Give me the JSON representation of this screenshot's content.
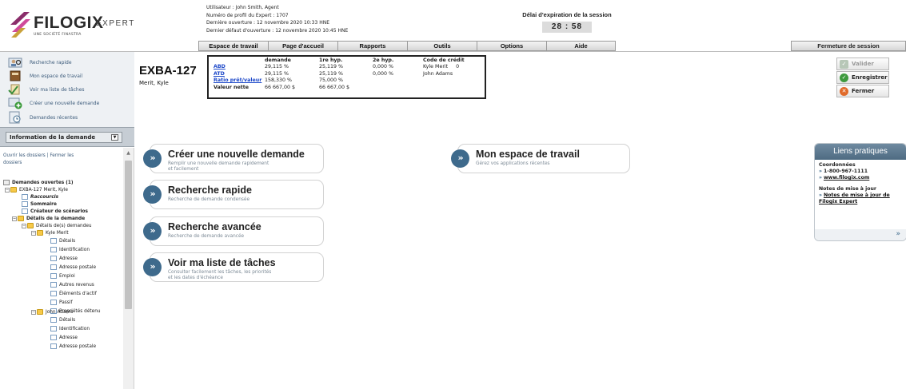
{
  "brand": {
    "name": "FILOGIX",
    "edition": "EXPERT",
    "tagline": "UNE SOCIÉTÉ FINASTRA",
    "colors": {
      "mark_top": "#8a2d6a",
      "mark_mid": "#d04a9a",
      "mark_bottom": "#c9a13a",
      "accent": "#3e6a8c"
    }
  },
  "user_info": {
    "user": "Utilisateur : John Smith, Agent",
    "profile": "Numéro de profil du Expert : 1707",
    "last_open": "Dernière ouverture : 12 novembre 2020 10:33 HNE",
    "last_failed": "Dernier défaut d'ouverture : 12 novembre 2020 10:45 HNE"
  },
  "session": {
    "label": "Délai d'expiration de la session",
    "timer": "28 : 58"
  },
  "topnav": {
    "tabs": [
      "Espace de travail",
      "Page d'accueil",
      "Rapports",
      "Outils",
      "Options",
      "Aide"
    ],
    "logout": "Fermeture de session"
  },
  "quickmenu": [
    {
      "label": "Recherche rapide",
      "icon": "person-search-icon"
    },
    {
      "label": "Mon espace de travail",
      "icon": "book-icon"
    },
    {
      "label": "Voir ma liste de tâches",
      "icon": "task-list-icon"
    },
    {
      "label": "Créer une nouvelle demande",
      "icon": "add-document-icon"
    },
    {
      "label": "Demandes récentes",
      "icon": "recent-document-icon"
    }
  ],
  "info_section": {
    "label": "Information de la demande"
  },
  "tree": {
    "open_folders": "Ouvrir les dossiers",
    "separator": "|",
    "close_folders": "Fermer les",
    "close_folders_2": "dossiers",
    "open_requests": "Demandes ouvertes (1)",
    "deal": "EXBA-127 Merit, Kyle",
    "shortcuts": "Raccourcis",
    "summary": "Sommaire",
    "scenario": "Créateur de scénarios",
    "details": "Détails de la demande",
    "applicants": "Détails de(s) demandeu",
    "applicant1": "Kyle Merit",
    "applicant1_items": [
      "Détails",
      "Identification",
      "Adresse",
      "Adresse postale",
      "Emploi",
      "Autres revenus",
      "Éléments d'actif",
      "Passif",
      "Propriétés détenu"
    ],
    "applicant2": "John Adams",
    "applicant2_items": [
      "Détails",
      "Identification",
      "Adresse",
      "Adresse postale"
    ]
  },
  "deal": {
    "id": "EXBA-127",
    "name": "Merit, Kyle",
    "columns": {
      "demande": "demande",
      "first": "1re hyp.",
      "second": "2e hyp.",
      "credit": "Code de crédit"
    },
    "rows": [
      {
        "label": "ABD",
        "demande": "29,115 %",
        "first": "25,119 %",
        "second": "0,000 %"
      },
      {
        "label": "ATD",
        "demande": "29,115 %",
        "first": "25,119 %",
        "second": "0,000 %"
      },
      {
        "label": "Ratio prêt/valeur",
        "demande": "158,330 %",
        "first": "75,000 %",
        "second": ""
      },
      {
        "label": "Valeur nette",
        "demande": "66 667,00 $",
        "first": "66 667,00 $",
        "second": ""
      }
    ],
    "credit_codes": [
      {
        "name": "Kyle Merit",
        "code": "0"
      },
      {
        "name": "John Adams",
        "code": ""
      }
    ]
  },
  "actions": {
    "validate": "Valider",
    "save": "Enregistrer",
    "close": "Fermer"
  },
  "cards": [
    {
      "title": "Créer une nouvelle demande",
      "sub1": "Remplir une nouvelle demande rapidement",
      "sub2": "et facilement"
    },
    {
      "title": "Recherche rapide",
      "sub1": "Recherche de demande condensée",
      "sub2": ""
    },
    {
      "title": "Recherche avancée",
      "sub1": "Recherche de demande avancée",
      "sub2": ""
    },
    {
      "title": "Voir ma liste de tâches",
      "sub1": "Consulter facilement les tâches, les priorités",
      "sub2": "et les dates d'échéance"
    },
    {
      "title": "Mon espace de travail",
      "sub1": "Gérez vos applications récentes",
      "sub2": ""
    }
  ],
  "links": {
    "title": "Liens pratiques",
    "contact_label": "Coordonnées",
    "phone": "1-800-967-1111",
    "site": "www.filogix.com",
    "notes_label": "Notes de mise à jour",
    "notes_link_1": "Notes de mise à jour de",
    "notes_link_2": "Filogix Expert",
    "raquo": "»",
    "more": "»"
  }
}
